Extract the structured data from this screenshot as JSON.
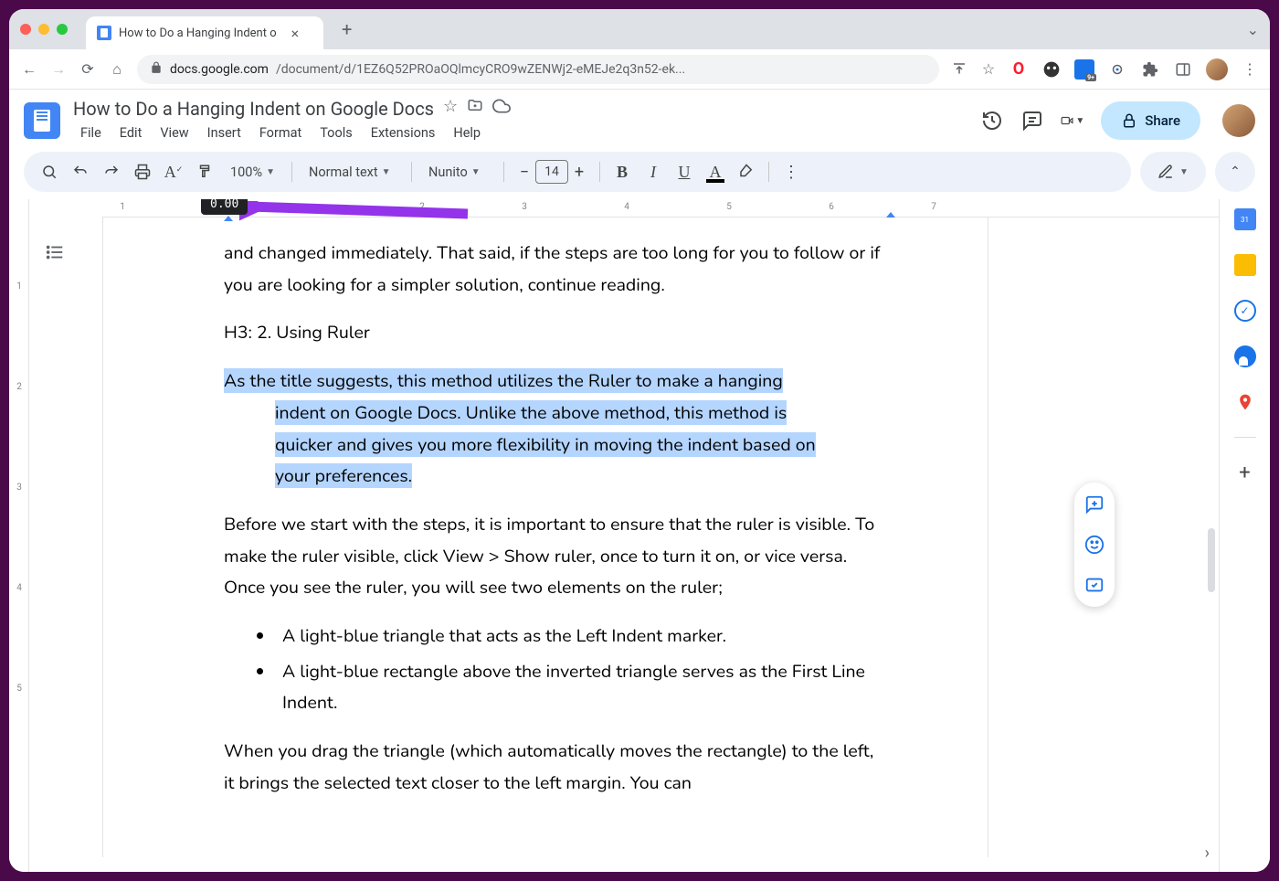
{
  "browser": {
    "tab_title": "How to Do a Hanging Indent o",
    "url_host": "docs.google.com",
    "url_path": "/document/d/1EZ6Q52PROaOQlmcyCRO9wZENWj2-eMEJe2q3n52-ek..."
  },
  "header": {
    "doc_title": "How to Do a Hanging Indent on Google Docs",
    "menus": [
      "File",
      "Edit",
      "View",
      "Insert",
      "Format",
      "Tools",
      "Extensions",
      "Help"
    ],
    "share_label": "Share"
  },
  "toolbar": {
    "zoom": "100%",
    "style": "Normal text",
    "font": "Nunito",
    "font_size": "14"
  },
  "ruler": {
    "tooltip": "0.00",
    "hticks": [
      "1",
      "2",
      "3",
      "4",
      "5",
      "6",
      "7"
    ],
    "vticks": [
      "1",
      "2",
      "3",
      "4",
      "5"
    ]
  },
  "document": {
    "para1": "and changed immediately. That said, if the steps are too long for you to follow or if you are looking for a simpler solution, continue reading.",
    "h3": "H3: 2. Using Ruler",
    "highlighted_line1": "As the title suggests, this method utilizes the Ruler to make a hanging",
    "highlighted_cont1": "indent on Google Docs. Unlike the above method, this method is",
    "highlighted_cont2": "quicker and gives you more flexibility in moving the indent based on",
    "highlighted_cont3": "your preferences.",
    "para3": "Before we start with the steps, it is important to ensure that the ruler is visible. To make the ruler visible, click View > Show ruler, once to turn it on, or vice versa. Once you see the ruler, you will see two elements on the ruler;",
    "bullet1": "A light-blue triangle that acts as the Left Indent marker.",
    "bullet2": "A light-blue rectangle above the inverted triangle serves as the First Line Indent.",
    "para4": "When you drag the triangle (which automatically moves the rectangle) to the left, it brings the selected text closer to the left margin. You can"
  }
}
